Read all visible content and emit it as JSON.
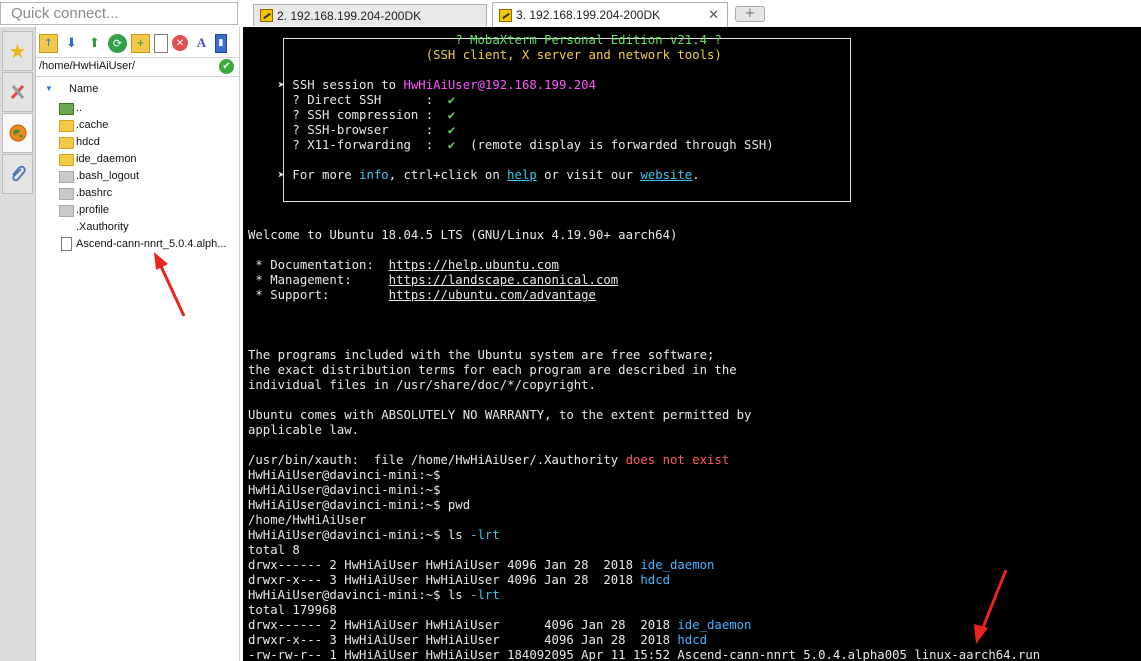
{
  "quick_connect": {
    "placeholder": "Quick connect..."
  },
  "tabs": [
    {
      "label": "2. 192.168.199.204-200DK",
      "active": false
    },
    {
      "label": "3. 192.168.199.204-200DK",
      "active": true
    }
  ],
  "new_tab_icon": "plus-icon",
  "side_tabs": [
    {
      "icon": "star-icon",
      "active": false
    },
    {
      "icon": "tools-icon",
      "active": false
    },
    {
      "icon": "sftp-globe-icon",
      "active": true
    },
    {
      "icon": "paperclip-icon",
      "active": false
    }
  ],
  "sftp": {
    "toolbar_icons": [
      "folder-up-icon",
      "download-icon",
      "upload-icon",
      "refresh-icon",
      "new-folder-icon",
      "new-file-icon",
      "delete-icon",
      "rename-icon",
      "follow-terminal-icon"
    ],
    "path": "/home/HwHiAiUser/",
    "column_name": "Name",
    "files": [
      {
        "name": "..",
        "type": "up"
      },
      {
        "name": ".cache",
        "type": "folder"
      },
      {
        "name": "hdcd",
        "type": "folder"
      },
      {
        "name": "ide_daemon",
        "type": "folder"
      },
      {
        "name": ".bash_logout",
        "type": "hidden"
      },
      {
        "name": ".bashrc",
        "type": "hidden"
      },
      {
        "name": ".profile",
        "type": "hidden"
      },
      {
        "name": ".Xauthority",
        "type": "blank"
      },
      {
        "name": "Ascend-cann-nnrt_5.0.4.alph...",
        "type": "file"
      }
    ]
  },
  "terminal": {
    "banner": {
      "title": "? MobaXterm Personal Edition v21.4 ?",
      "subtitle": "(SSH client, X server and network tools)",
      "session_prefix": "➤ SSH session to ",
      "session_target": "HwHiAiUser@192.168.199.204",
      "features": [
        {
          "label": "  ? Direct SSH      :  ",
          "value": "✔",
          "note": ""
        },
        {
          "label": "  ? SSH compression :  ",
          "value": "✔",
          "note": ""
        },
        {
          "label": "  ? SSH-browser     :  ",
          "value": "✔",
          "note": ""
        },
        {
          "label": "  ? X11-forwarding  :  ",
          "value": "✔",
          "note": "  (remote display is forwarded through SSH)"
        }
      ],
      "more_prefix": "➤ For more ",
      "more_info": "info",
      "more_mid": ", ctrl+click on ",
      "more_help": "help",
      "more_mid2": " or visit our ",
      "more_website": "website",
      "more_end": "."
    },
    "welcome": "Welcome to Ubuntu 18.04.5 LTS (GNU/Linux 4.19.90+ aarch64)",
    "links": [
      {
        "label": " * Documentation:  ",
        "url": "https://help.ubuntu.com"
      },
      {
        "label": " * Management:     ",
        "url": "https://landscape.canonical.com"
      },
      {
        "label": " * Support:        ",
        "url": "https://ubuntu.com/advantage"
      }
    ],
    "motd": [
      "The programs included with the Ubuntu system are free software;",
      "the exact distribution terms for each program are described in the",
      "individual files in /usr/share/doc/*/copyright.",
      "",
      "Ubuntu comes with ABSOLUTELY NO WARRANTY, to the extent permitted by",
      "applicable law."
    ],
    "xauth_prefix": "/usr/bin/xauth:  file /home/HwHiAiUser/.Xauthority ",
    "xauth_err": "does not exist",
    "prompt": "HwHiAiUser@davinci-mini:~$",
    "cmd_pwd": " pwd",
    "pwd_out": "/home/HwHiAiUser",
    "cmd_ls": " ls ",
    "cmd_ls_flag": "-lrt",
    "ls1": {
      "total": "total 8",
      "rows": [
        {
          "meta": "drwx------ 2 HwHiAiUser HwHiAiUser 4096 Jan 28  2018 ",
          "name": "ide_daemon",
          "kind": "dir"
        },
        {
          "meta": "drwxr-x--- 3 HwHiAiUser HwHiAiUser 4096 Jan 28  2018 ",
          "name": "hdcd",
          "kind": "dir"
        }
      ]
    },
    "ls2": {
      "total": "total 179968",
      "rows": [
        {
          "meta": "drwx------ 2 HwHiAiUser HwHiAiUser      4096 Jan 28  2018 ",
          "name": "ide_daemon",
          "kind": "dir"
        },
        {
          "meta": "drwxr-x--- 3 HwHiAiUser HwHiAiUser      4096 Jan 28  2018 ",
          "name": "hdcd",
          "kind": "dir"
        },
        {
          "meta": "-rw-rw-r-- 1 HwHiAiUser HwHiAiUser 184092095 Apr 11 15:52 ",
          "name": "Ascend-cann-nnrt_5.0.4.alpha005_linux-aarch64.run",
          "kind": "file"
        }
      ]
    }
  },
  "colors": {
    "annotation_arrow": "#e8251f",
    "terminal_bg": "#000000",
    "ok_green": "#3aaa35"
  }
}
